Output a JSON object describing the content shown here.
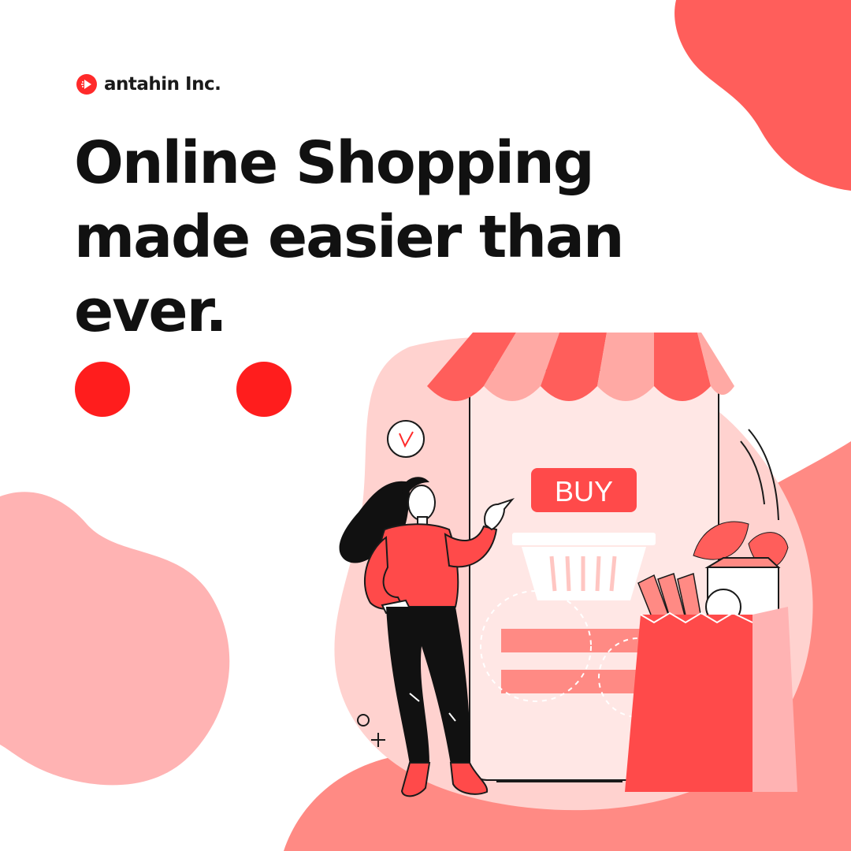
{
  "brand": {
    "name": "antahin Inc.",
    "icon": "play-icon"
  },
  "headline": {
    "line1": "Online Shopping",
    "line2": "made easier than",
    "line3": "ever."
  },
  "illustration": {
    "buy_label": "BUY",
    "check_mark": "✓"
  },
  "colors": {
    "accent": "#ff4a4a",
    "blob_light": "#ffb3b3",
    "blob_mid": "#ff8a84",
    "dot": "#ff1d1d",
    "text": "#111111"
  }
}
